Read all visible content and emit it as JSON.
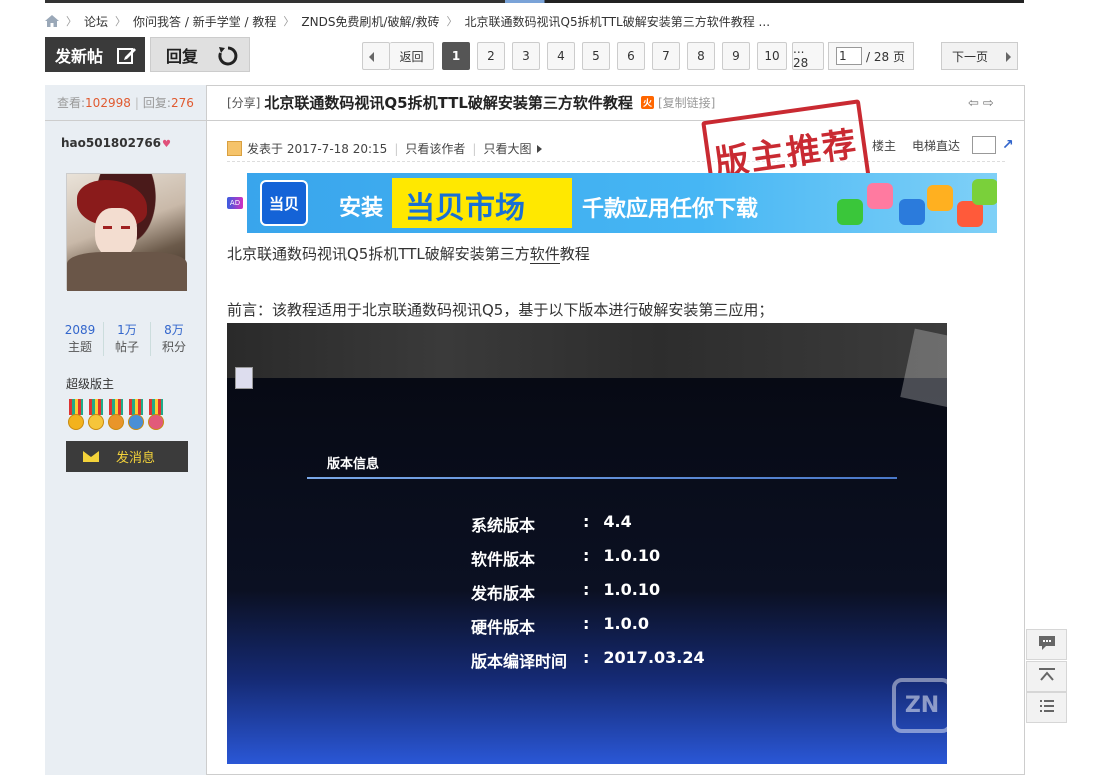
{
  "breadcrumb": {
    "items": [
      "论坛",
      "你问我答 / 新手学堂 / 教程",
      "ZNDS免费刷机/破解/救砖",
      "北京联通数码视讯Q5拆机TTL破解安装第三方软件教程 ..."
    ]
  },
  "actions": {
    "post_label": "发新帖",
    "reply_label": "回复"
  },
  "pagination": {
    "back_label": "返回",
    "pages": [
      "1",
      "2",
      "3",
      "4",
      "5",
      "6",
      "7",
      "8",
      "9",
      "10",
      "... 28"
    ],
    "current": "1",
    "input_value": "1",
    "total_label": "/ 28 页",
    "next_label": "下一页"
  },
  "thread_stats": {
    "views_label": "查看:",
    "views": "102998",
    "sep": "|",
    "replies_label": "回复:",
    "replies": "276"
  },
  "thread": {
    "tag": "[分享]",
    "title": "北京联通数码视讯Q5拆机TTL破解安装第三方软件教程",
    "hot_badge": "火",
    "copy_link": "[复制链接]"
  },
  "author": {
    "name": "hao501802766",
    "stats": [
      {
        "value": "2089",
        "label": "主题"
      },
      {
        "value": "1万",
        "label": "帖子"
      },
      {
        "value": "8万",
        "label": "积分"
      }
    ],
    "role": "超级版主",
    "message_button": "发消息"
  },
  "post_meta": {
    "posted": "发表于 2017-7-18 20:15",
    "only_author": "只看该作者",
    "only_big_image": "只看大图",
    "floor_label": "楼主",
    "jump_label": "电梯直达"
  },
  "stamp_text": "版主推荐",
  "ad": {
    "tag": "AD",
    "logo_text": "当贝",
    "install": "安装",
    "market": "当贝市场",
    "slogan": "千款应用任你下载"
  },
  "content": {
    "line1_prefix": "北京联通数码视讯Q5拆机TTL破解安装第三方",
    "line1_link": "软件",
    "line1_suffix": "教程",
    "line2": "前言：该教程适用于北京联通数码视讯Q5，基于以下版本进行破解安装第三应用；"
  },
  "photo": {
    "panel_title": "版本信息",
    "rows": [
      {
        "k": "系统版本",
        "v": "4.4"
      },
      {
        "k": "软件版本",
        "v": "1.0.10"
      },
      {
        "k": "发布版本",
        "v": "1.0.10"
      },
      {
        "k": "硬件版本",
        "v": "1.0.0"
      },
      {
        "k": "版本编译时间",
        "v": "2017.03.24"
      }
    ],
    "colon": ":",
    "watermark": "ZN"
  },
  "colors": {
    "accent": "#3366cc",
    "highlight": "#e05a30",
    "stamp": "#c4141c"
  }
}
